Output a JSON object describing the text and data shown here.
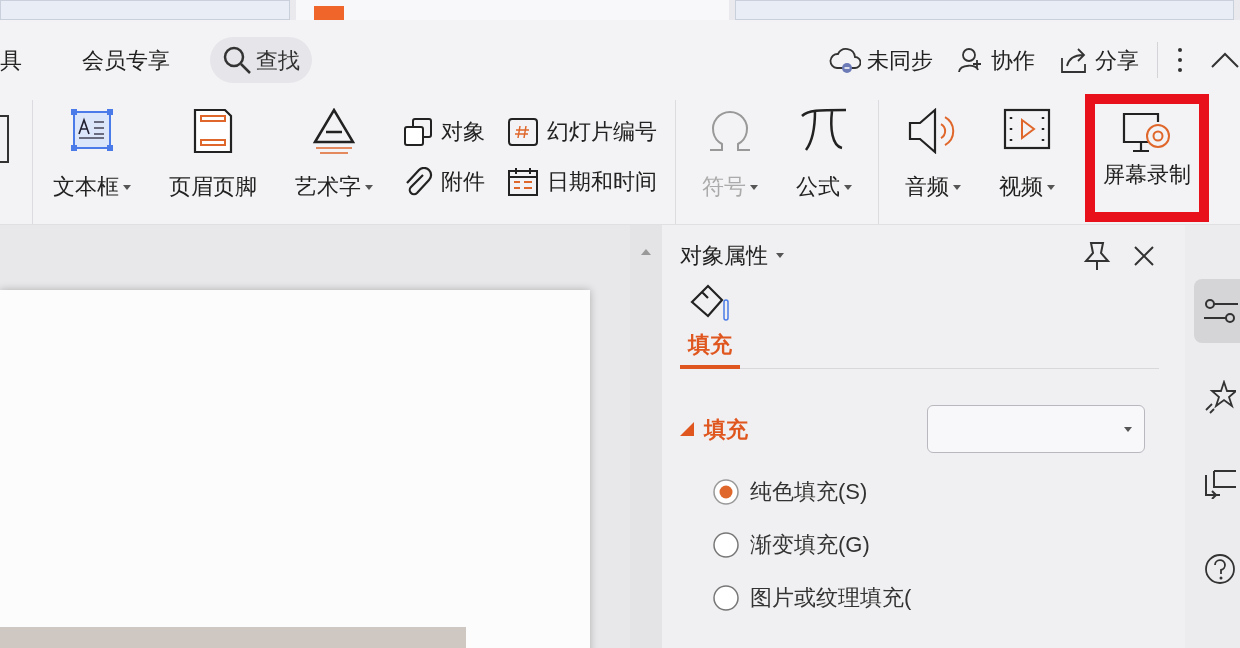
{
  "document_tabs": [
    {
      "selected": false
    },
    {
      "selected": true
    },
    {
      "selected": false
    }
  ],
  "menu": [
    {
      "label": "具"
    },
    {
      "label": "会员专享"
    }
  ],
  "search": {
    "label": "查找"
  },
  "actions": [
    {
      "label": "未同步"
    },
    {
      "label": "协作"
    },
    {
      "label": "分享"
    }
  ],
  "ribbon": {
    "groups": [
      {
        "items": [
          {
            "kind": "large",
            "label": "文本框",
            "dropdown": true,
            "disabled": false,
            "highlighted": false
          },
          {
            "kind": "large",
            "label": "页眉页脚",
            "dropdown": false,
            "disabled": false,
            "highlighted": false
          },
          {
            "kind": "large",
            "label": "艺术字",
            "dropdown": true,
            "disabled": false,
            "highlighted": false
          },
          {
            "kind": "small",
            "label": "对象"
          },
          {
            "kind": "small",
            "label": "附件"
          },
          {
            "kind": "small",
            "label": "幻灯片编号"
          },
          {
            "kind": "small",
            "label": "日期和时间"
          }
        ]
      },
      {
        "items": [
          {
            "kind": "large",
            "label": "符号",
            "dropdown": true,
            "disabled": true,
            "highlighted": false
          },
          {
            "kind": "large",
            "label": "公式",
            "dropdown": true,
            "disabled": false,
            "highlighted": false
          }
        ]
      },
      {
        "items": [
          {
            "kind": "large",
            "label": "音频",
            "dropdown": true,
            "disabled": false,
            "highlighted": false
          },
          {
            "kind": "large",
            "label": "视频",
            "dropdown": true,
            "disabled": false,
            "highlighted": false
          },
          {
            "kind": "large",
            "label": "屏幕录制",
            "dropdown": false,
            "disabled": false,
            "highlighted": true
          }
        ]
      }
    ]
  },
  "panel": {
    "title": "对象属性",
    "tabs": [
      {
        "label": "填充",
        "selected": true
      }
    ],
    "section": {
      "label": "填充",
      "expanded": true
    },
    "fill_options": [
      {
        "label": "纯色填充(S)",
        "selected": true
      },
      {
        "label": "渐变填充(G)",
        "selected": false
      },
      {
        "label": "图片或纹理填充(",
        "selected": false
      }
    ]
  },
  "sidebar": [
    {
      "selected": true
    },
    {
      "selected": false
    },
    {
      "selected": false
    },
    {
      "selected": false
    }
  ]
}
